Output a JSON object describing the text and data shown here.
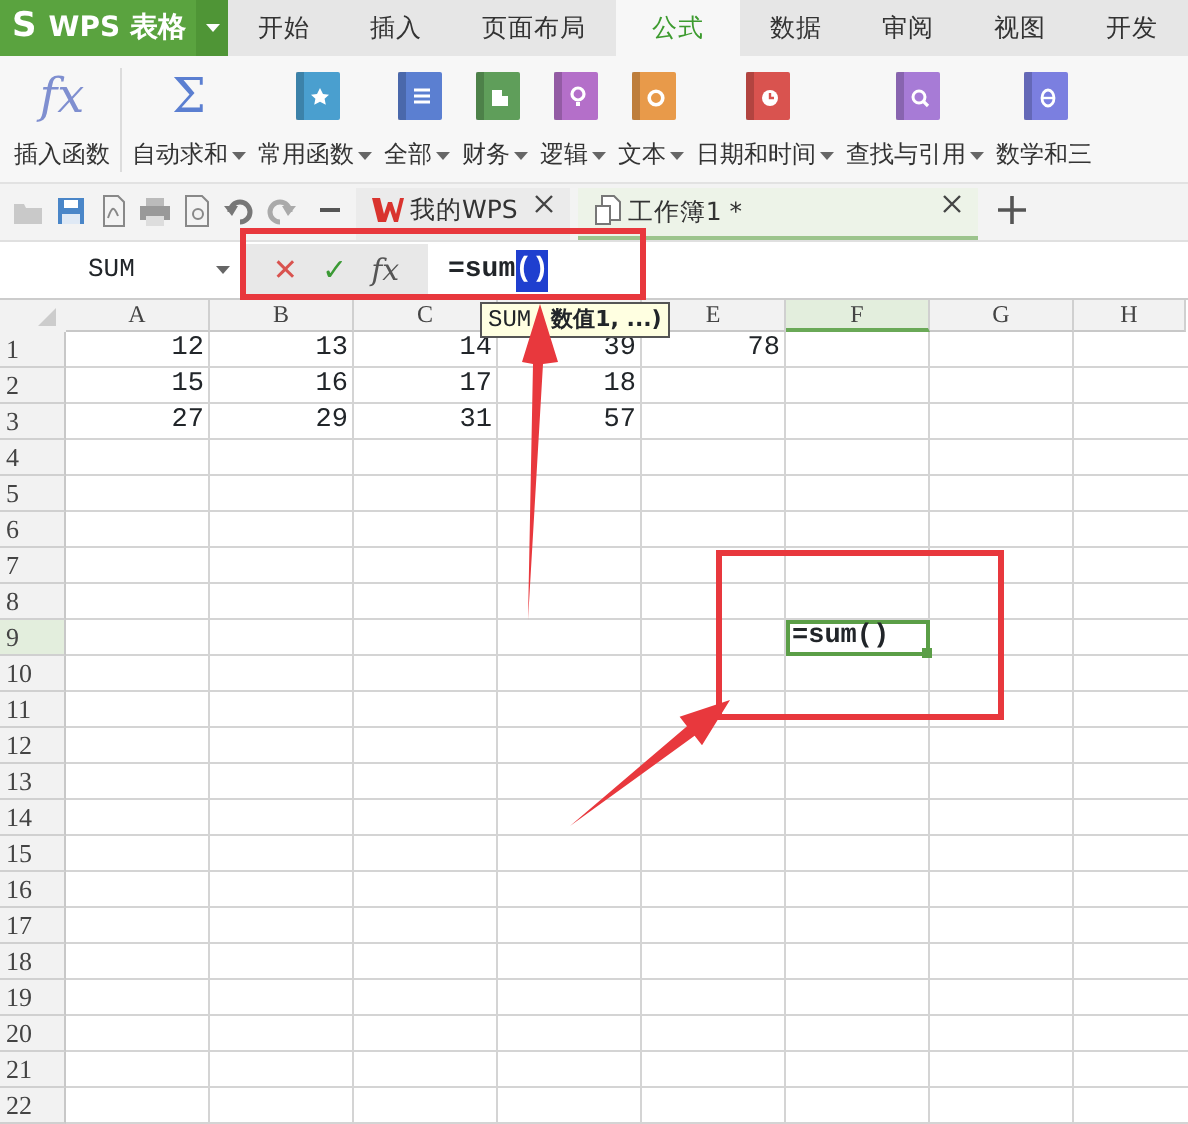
{
  "app_button": {
    "logo": "S",
    "label": "WPS 表格"
  },
  "menu_tabs": [
    {
      "label": "开始",
      "selected": false
    },
    {
      "label": "插入",
      "selected": false
    },
    {
      "label": "页面布局",
      "selected": false
    },
    {
      "label": "公式",
      "selected": true
    },
    {
      "label": "数据",
      "selected": false
    },
    {
      "label": "审阅",
      "selected": false
    },
    {
      "label": "视图",
      "selected": false
    },
    {
      "label": "开发",
      "selected": false
    }
  ],
  "ribbon": [
    {
      "kind": "glyph",
      "glyph": "fx",
      "label": "插入函数",
      "dropdown": false
    },
    {
      "kind": "glyph",
      "glyph": "Σ",
      "label": "自动求和",
      "dropdown": true
    },
    {
      "kind": "book",
      "color": "#4a9fcf",
      "label": "常用函数",
      "dropdown": true
    },
    {
      "kind": "book",
      "color": "#5b7fd1",
      "label": "全部",
      "dropdown": true
    },
    {
      "kind": "book",
      "color": "#5f9e5a",
      "label": "财务",
      "dropdown": true
    },
    {
      "kind": "book",
      "color": "#b46fc9",
      "label": "逻辑",
      "dropdown": true
    },
    {
      "kind": "book",
      "color": "#e89a4a",
      "label": "文本",
      "dropdown": true
    },
    {
      "kind": "book",
      "color": "#d9534f",
      "label": "日期和时间",
      "dropdown": true
    },
    {
      "kind": "book",
      "color": "#a77bd6",
      "label": "查找与引用",
      "dropdown": true
    },
    {
      "kind": "book",
      "color": "#7b7fe0",
      "label": "数学和三",
      "dropdown": false
    }
  ],
  "doc_tabs": [
    {
      "label": "我的WPS",
      "selected": false
    },
    {
      "label": "工作簿1 *",
      "selected": true
    }
  ],
  "formula_bar": {
    "name_box": "SUM",
    "cancel": "✕",
    "confirm": "✓",
    "fx": "fx",
    "formula": "=sum",
    "formula_selected": "()"
  },
  "tooltip": {
    "function": "SUM",
    "arguments": "数值1, ...)"
  },
  "columns": [
    {
      "label": "A",
      "selected": false
    },
    {
      "label": "B",
      "selected": false
    },
    {
      "label": "C",
      "selected": false
    },
    {
      "selected": false
    },
    {
      "label": "E",
      "selected": false
    },
    {
      "label": "F",
      "selected": true
    },
    {
      "label": "G",
      "selected": false
    },
    {
      "label": "H",
      "selected": false
    }
  ],
  "rows": [
    {
      "label": "1",
      "selected": false,
      "cells": [
        "12",
        "13",
        "14",
        "39",
        "78"
      ]
    },
    {
      "label": "2",
      "selected": false,
      "cells": [
        "15",
        "16",
        "17",
        "18"
      ]
    },
    {
      "label": "3",
      "selected": false,
      "cells": [
        "27",
        "29",
        "31",
        "57"
      ]
    },
    {
      "label": "4",
      "selected": false
    },
    {
      "label": "5",
      "selected": false
    },
    {
      "label": "6",
      "selected": false
    },
    {
      "label": "7",
      "selected": false
    },
    {
      "label": "8",
      "selected": false
    },
    {
      "label": "9",
      "selected": true,
      "active_cell": "=sum()"
    },
    {
      "label": "10",
      "selected": false
    },
    {
      "label": "11",
      "selected": false
    },
    {
      "label": "12",
      "selected": false
    },
    {
      "label": "13",
      "selected": false
    },
    {
      "label": "14",
      "selected": false
    },
    {
      "label": "15",
      "selected": false
    },
    {
      "label": "16",
      "selected": false
    },
    {
      "label": "17",
      "selected": false
    },
    {
      "label": "18",
      "selected": false
    },
    {
      "label": "19",
      "selected": false
    },
    {
      "label": "20",
      "selected": false
    },
    {
      "label": "21",
      "selected": false
    },
    {
      "label": "22",
      "selected": false
    }
  ]
}
